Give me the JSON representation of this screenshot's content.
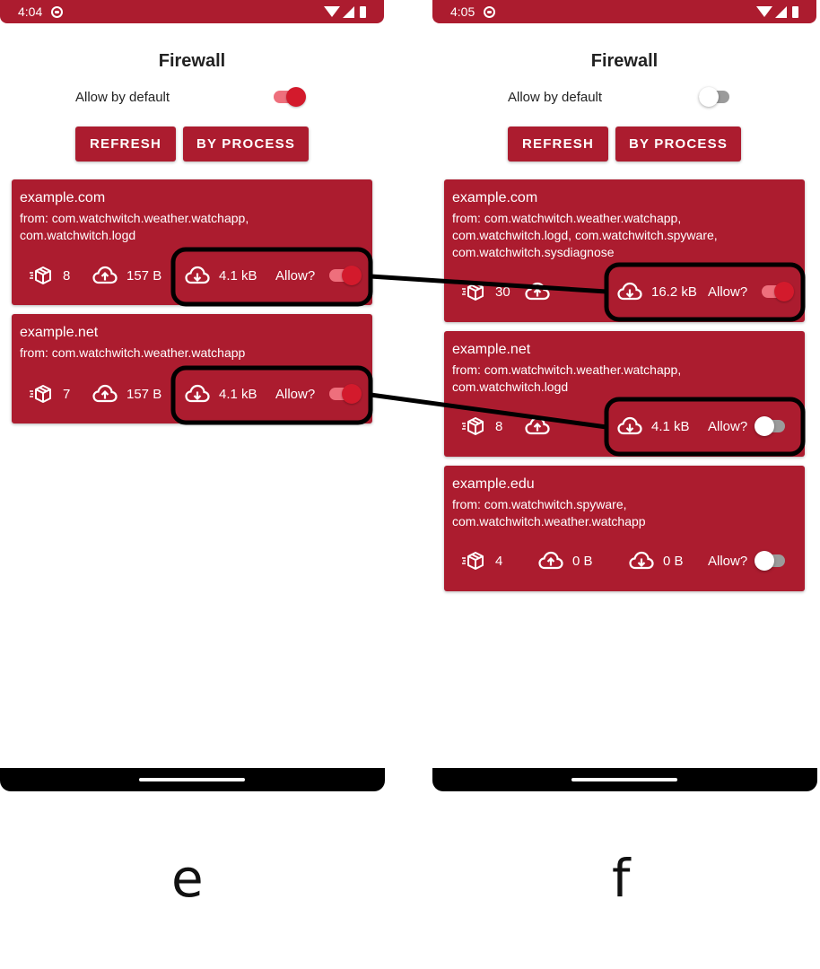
{
  "colors": {
    "accent": "#ac1c2f",
    "switch_on": "#d31a2c",
    "annotation": "#000000"
  },
  "icons": {
    "packets": "package-box-icon",
    "upload": "cloud-upload-icon",
    "download": "cloud-download-icon"
  },
  "left": {
    "status_time": "4:04",
    "title": "Firewall",
    "allow_default_label": "Allow by default",
    "allow_default_on": true,
    "refresh_label": "REFRESH",
    "by_process_label": "BY PROCESS",
    "cards": [
      {
        "host": "example.com",
        "from_lines": [
          "from: com.watchwitch.weather.watchapp,",
          "com.watchwitch.logd"
        ],
        "packets": "8",
        "upload": "157 B",
        "download": "4.1 kB",
        "allow_label": "Allow?",
        "allowed": true
      },
      {
        "host": "example.net",
        "from_lines": [
          "from: com.watchwitch.weather.watchapp"
        ],
        "packets": "7",
        "upload": "157 B",
        "download": "4.1 kB",
        "allow_label": "Allow?",
        "allowed": true
      }
    ],
    "caption": "e"
  },
  "right": {
    "status_time": "4:05",
    "title": "Firewall",
    "allow_default_label": "Allow by default",
    "allow_default_on": false,
    "refresh_label": "REFRESH",
    "by_process_label": "BY PROCESS",
    "cards": [
      {
        "host": "example.com",
        "from_lines": [
          "from: com.watchwitch.weather.watchapp,",
          "com.watchwitch.logd, com.watchwitch.spyware,",
          "com.watchwitch.sysdiagnose"
        ],
        "packets": "30",
        "upload": "",
        "download": "16.2 kB",
        "allow_label": "Allow?",
        "allowed": true
      },
      {
        "host": "example.net",
        "from_lines": [
          "from: com.watchwitch.weather.watchapp,",
          "com.watchwitch.logd"
        ],
        "packets": "8",
        "upload": "",
        "download": "4.1 kB",
        "allow_label": "Allow?",
        "allowed": false
      },
      {
        "host": "example.edu",
        "from_lines": [
          "from: com.watchwitch.spyware,",
          "com.watchwitch.weather.watchapp"
        ],
        "packets": "4",
        "upload": "0 B",
        "download": "0 B",
        "allow_label": "Allow?",
        "allowed": false
      }
    ],
    "caption": "f"
  }
}
